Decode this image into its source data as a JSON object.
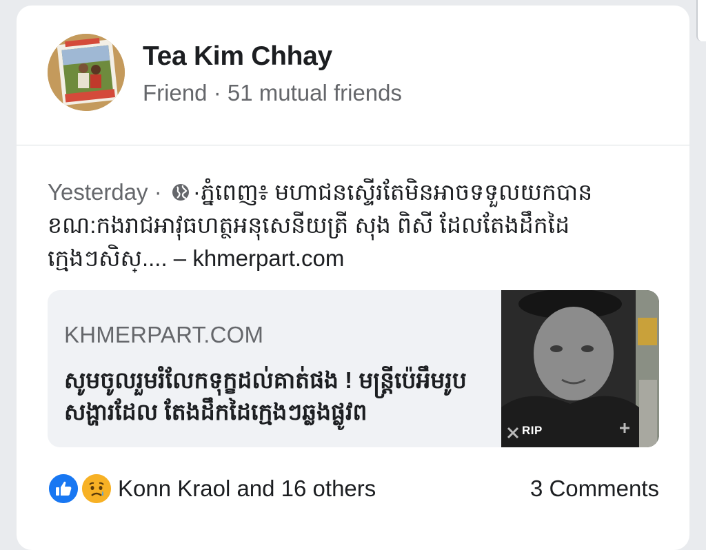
{
  "profile": {
    "name": "Tea Kim Chhay",
    "relationship": "Friend",
    "separator": " · ",
    "mutual_friends": "51 mutual friends"
  },
  "post": {
    "time": "Yesterday",
    "dot": " · ",
    "privacy_icon": "globe-icon",
    "text": "·ភ្នំពេញ៖ មហាជនស្ទើរតែមិនអាចទទួលយកបាន ខណ:កងរាជអាវុធហត្ថអនុសេនីយត្រី សុង ពិសី ដែលតែងដឹកដៃក្មេងៗសិស្.... – khmerpart.com"
  },
  "link_preview": {
    "domain": "KHMERPART.COM",
    "title": "សូមចូលរួមរំលែកទុក្ខដល់គាត់ផង ! មន្ត្រីប៉េអឹមរូបសង្ហារដែល តែងដឹកដៃក្មេងៗឆ្លងផ្លូវព",
    "thumbnail_caption": "RIP"
  },
  "footer": {
    "reaction_icons": [
      "like-icon",
      "sad-icon"
    ],
    "reaction_text": "Konn Kraol and 16 others",
    "comments": "3 Comments"
  },
  "colors": {
    "accent_blue": "#1877f2",
    "text_primary": "#1c1e21",
    "text_secondary": "#65676b",
    "link_bg": "#f0f2f5"
  }
}
